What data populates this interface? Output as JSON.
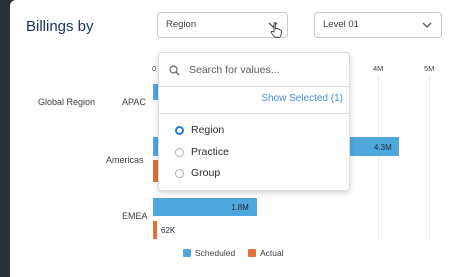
{
  "title": "Billings by",
  "group_select": {
    "value": "Region"
  },
  "level_select": {
    "value": "Level 01"
  },
  "axis_ticks": [
    "0",
    "4M",
    "5M"
  ],
  "row_group_label": "Global Region",
  "dropdown": {
    "search_placeholder": "Search for values...",
    "show_selected": "Show Selected (1)",
    "options": [
      {
        "label": "Region",
        "selected": true
      },
      {
        "label": "Practice",
        "selected": false
      },
      {
        "label": "Group",
        "selected": false
      }
    ]
  },
  "chart_data": {
    "type": "bar",
    "orientation": "horizontal",
    "categories": [
      "APAC",
      "Americas",
      "EMEA"
    ],
    "series": [
      {
        "name": "Scheduled",
        "color": "#4ea7dd",
        "labels": [
          "",
          "4.3M",
          "1.8M"
        ]
      },
      {
        "name": "Actual",
        "color": "#e2703a",
        "labels": [
          "",
          "",
          "62K"
        ]
      }
    ],
    "legend": "bottom"
  },
  "colors": {
    "accent": "#1b7fd4",
    "scheduled": "#4ea7dd",
    "actual": "#e2703a"
  }
}
